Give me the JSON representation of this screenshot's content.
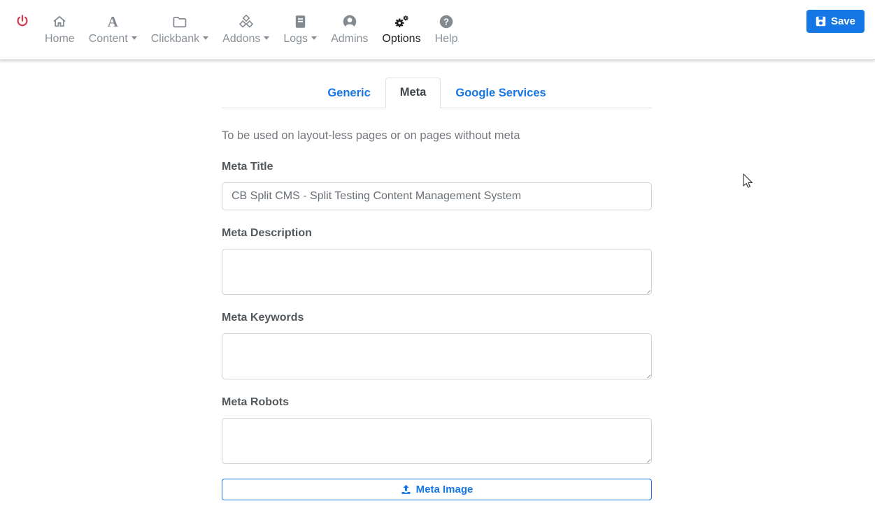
{
  "colors": {
    "accent": "#1577e6",
    "danger": "#dc3545",
    "nav_inactive": "#8a9198",
    "nav_active": "#1d2124",
    "border": "#ced3d9"
  },
  "navbar": {
    "power": {
      "icon": "power-icon"
    },
    "items": [
      {
        "label": "Home",
        "icon": "home-icon",
        "caret": false,
        "active": false
      },
      {
        "label": "Content",
        "icon": "font-a-icon",
        "caret": true,
        "active": false
      },
      {
        "label": "Clickbank",
        "icon": "folder-icon",
        "caret": true,
        "active": false
      },
      {
        "label": "Addons",
        "icon": "cubes-icon",
        "caret": true,
        "active": false
      },
      {
        "label": "Logs",
        "icon": "journal-icon",
        "caret": true,
        "active": false
      },
      {
        "label": "Admins",
        "icon": "user-circle-icon",
        "caret": false,
        "active": false
      },
      {
        "label": "Options",
        "icon": "gears-icon",
        "caret": false,
        "active": true
      },
      {
        "label": "Help",
        "icon": "question-circle-icon",
        "caret": false,
        "active": false
      }
    ],
    "save_button": {
      "label": "Save",
      "icon": "save-icon"
    }
  },
  "tabs": [
    {
      "label": "Generic",
      "active": false
    },
    {
      "label": "Meta",
      "active": true
    },
    {
      "label": "Google Services",
      "active": false
    }
  ],
  "form": {
    "intro": "To be used on layout-less pages or on pages without meta",
    "fields": [
      {
        "label": "Meta Title",
        "type": "input",
        "value": "CB Split CMS - Split Testing Content Management System"
      },
      {
        "label": "Meta Description",
        "type": "textarea",
        "value": ""
      },
      {
        "label": "Meta Keywords",
        "type": "textarea",
        "value": ""
      },
      {
        "label": "Meta Robots",
        "type": "textarea",
        "value": ""
      }
    ],
    "meta_image_button": {
      "label": "Meta Image",
      "icon": "upload-icon"
    }
  }
}
